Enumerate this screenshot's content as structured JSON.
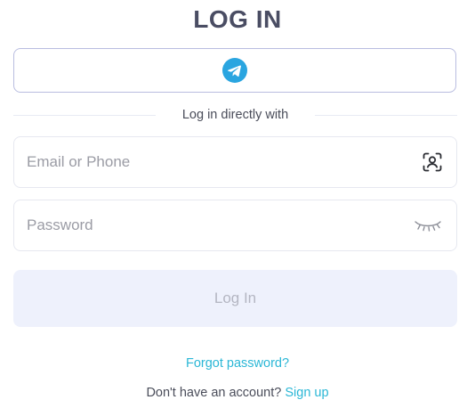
{
  "header": {
    "title": "LOG IN"
  },
  "social_login": {
    "provider_icon": "telegram-icon",
    "brand_color": "#2aa5e0"
  },
  "divider": {
    "text": "Log in directly with"
  },
  "form": {
    "email": {
      "placeholder": "Email or Phone",
      "value": "",
      "icon": "user-scan-icon"
    },
    "password": {
      "placeholder": "Password",
      "value": "",
      "icon": "eye-closed-icon"
    },
    "submit_label": "Log In"
  },
  "links": {
    "forgot_password": "Forgot password?",
    "no_account_text": "Don't have an account?",
    "sign_up": "Sign up"
  },
  "colors": {
    "accent": "#2bb7d6",
    "title": "#4a4d63",
    "disabled_button_bg": "#eef1fc",
    "disabled_button_text": "#b4b6c2"
  }
}
